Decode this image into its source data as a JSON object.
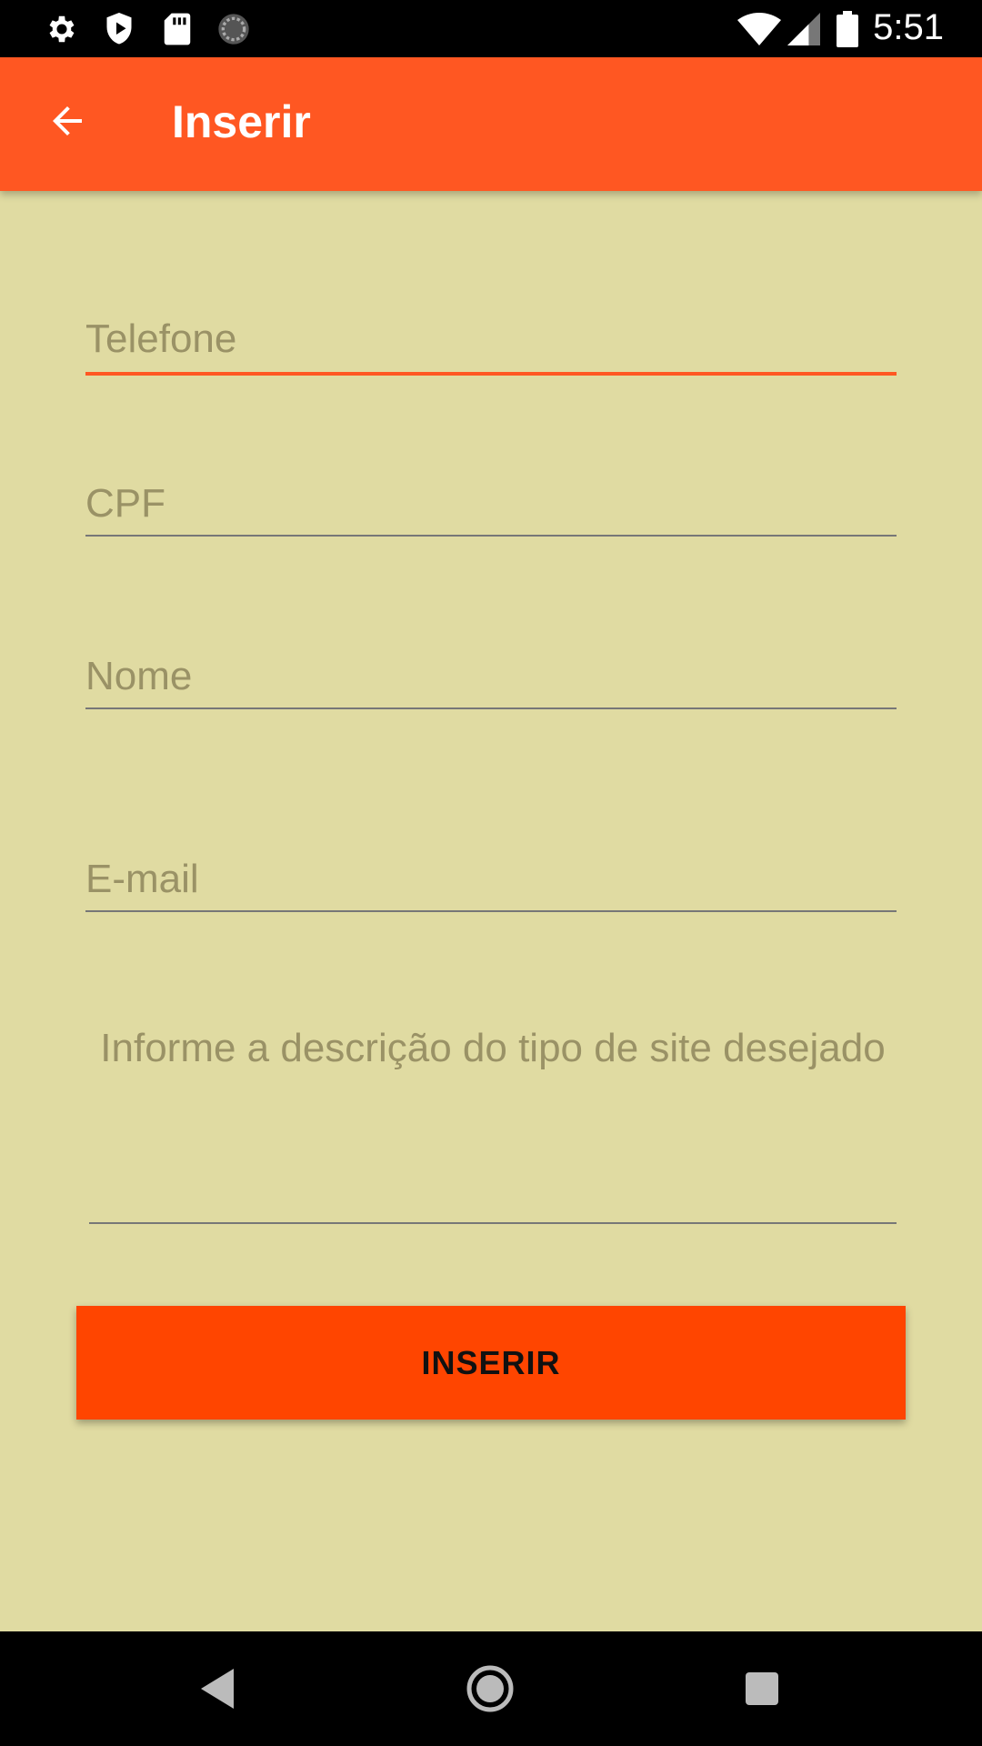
{
  "status_bar": {
    "time": "5:51",
    "left_icons": [
      "settings-icon",
      "shield-play-icon",
      "sd-card-icon",
      "loading-circle-icon"
    ],
    "right_icons": [
      "wifi-icon",
      "signal-icon",
      "battery-icon"
    ]
  },
  "app_bar": {
    "title": "Inserir",
    "back_icon": "arrow-back-icon",
    "color": "#ff5722"
  },
  "form": {
    "telefone_placeholder": "Telefone",
    "cpf_placeholder": "CPF",
    "nome_placeholder": "Nome",
    "email_placeholder": "E-mail",
    "descricao_placeholder": "Informe a descrição do tipo de site desejado",
    "active_field": "Telefone"
  },
  "button": {
    "label": "INSERIR",
    "color": "#ff4500"
  },
  "nav_bar": {
    "icons": [
      "back-triangle-icon",
      "home-circle-icon",
      "recents-square-icon"
    ]
  },
  "colors": {
    "background": "#e0dba2",
    "accent": "#ff5722"
  }
}
